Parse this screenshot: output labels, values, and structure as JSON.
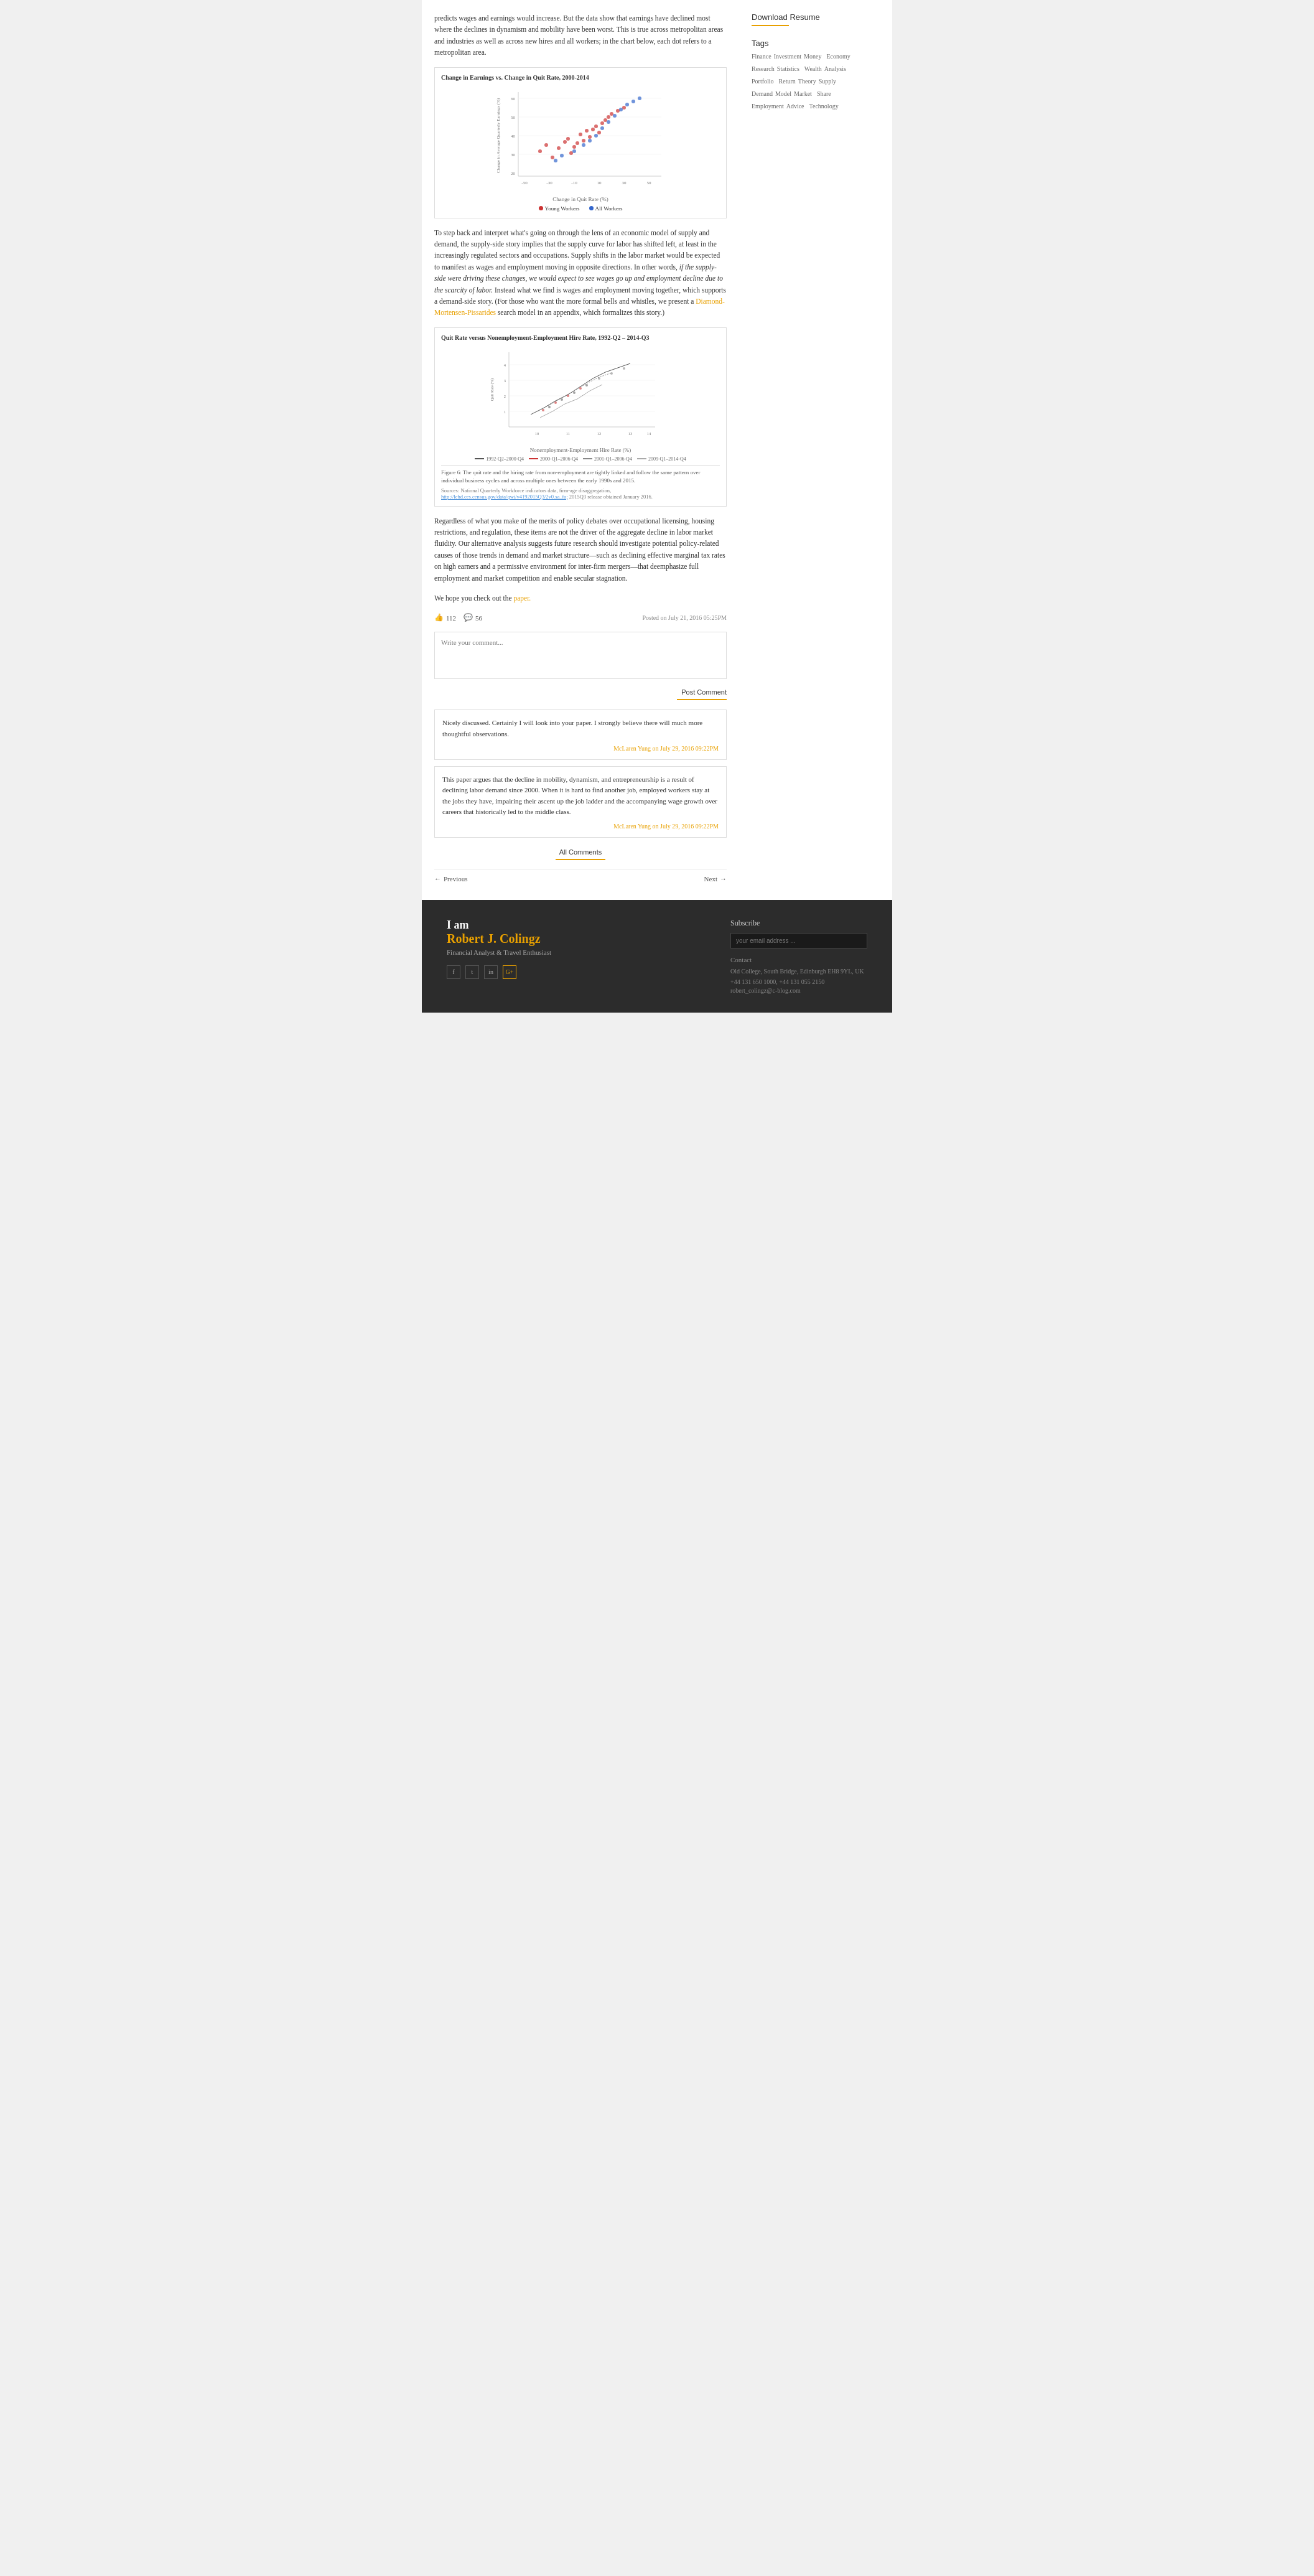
{
  "sidebar": {
    "download_resume": "Download Resume",
    "tags_title": "Tags",
    "tags": [
      "Finance",
      "Investment",
      "Money",
      "Economy",
      "Research",
      "Statistics",
      "Wealth",
      "Analysis",
      "Portfolio",
      "Return",
      "Theory",
      "Supply",
      "Demand",
      "Model",
      "Market",
      "Share",
      "Employment",
      "Advice",
      "Technology"
    ]
  },
  "article": {
    "intro_text": "predicts wages and earnings would increase. But the data show that earnings have declined most where the declines in dynamism and mobility have been worst. This is true across metropolitan areas and industries as well as across new hires and all workers; in the chart below, each dot refers to a metropolitan area.",
    "chart1_title": "Change in Earnings vs. Change in Quit Rate, 2000-2014",
    "chart1_x_label": "Change in Quit Rate (%)",
    "chart1_y_label": "Change in Average Quarterly Earnings (%)",
    "legend_young": "Young Workers",
    "legend_all": "All Workers",
    "body_text1": "To step back and interpret what's going on through the lens of an economic model of supply and demand, the supply-side story implies that the supply curve for labor has shifted left, at least in the increasingly regulated sectors and occupations. Supply shifts in the labor market would be expected to manifest as wages and employment moving in opposite directions. In other words,",
    "body_italic": "if the supply-side were driving these changes, we would expect to see wages go up and employment decline due to the scarcity of labor.",
    "body_text2": "Instead what we find is wages and employment moving together, which supports a demand-side story. (For those who want the more formal bells and whistles, we present a",
    "body_link": "Diamond-Mortensen-Pissarides",
    "body_text3": "search model in an appendix, which formalizes this story.)",
    "chart2_title": "Quit Rate versus Nonemployment-Employment Hire Rate, 1992-Q2 – 2014-Q3",
    "chart2_x_label": "Nonemployment-Employment Hire Rate (%)",
    "chart2_y_label": "Quit Rate (%)",
    "chart2_legend": [
      "1992-Q2–2000-Q4",
      "2000-Q1–2006-Q4",
      "2001-Q1–2006-Q4",
      "2009-Q1–2014-Q4"
    ],
    "figure_caption": "Figure 6: The quit rate and the hiring rate from non-employment are tightly linked and follow the same pattern over individual business cycles and across multiple ones between the early 1990s and 2015.",
    "figure_source_label": "Sources: National Quarterly Workforce indicators data, firm-age disaggregation,",
    "figure_source_url": "http://lehd.ces.census.gov/data/qwi/v4192015Q3/2v0.sa_fa;",
    "figure_source_end": "2015Q3 release obtained January 2016.",
    "body_text4": "Regardless of what you make of the merits of policy debates over occupational licensing, housing restrictions, and regulation, these items are not the driver of the aggregate decline in labor market fluidity. Our alternative analysis suggests future research should investigate potential policy-related causes of those trends in demand and market structure—such as declining effective marginal tax rates on high earners and a permissive environment for inter-firm mergers—that deemphasize full employment and market competition and enable secular stagnation.",
    "body_text5": "We hope you check out the",
    "paper_link": "paper.",
    "likes_count": "112",
    "comments_count": "56",
    "posted_on": "Posted on July 21, 2016 05:25PM",
    "comment_placeholder": "Write your comment...",
    "post_comment_label": "Post Comment",
    "comments": [
      {
        "text": "Nicely discussed. Certainly I will look into your paper. I strongly believe there will much more thoughtful observations.",
        "author": "McLaren Yung on July 29, 2016 09:22PM"
      },
      {
        "text": "This paper argues that the decline in mobility, dynamism, and entrepreneurship is a result of declining labor demand since 2000. When it is hard to find another job, employed workers stay at the jobs they have, impairing their ascent up the job ladder and the accompanying wage growth over careers that historically led to the middle class.",
        "author": "McLaren Yung on July 29, 2016 09:22PM"
      }
    ],
    "all_comments_label": "All Comments",
    "prev_label": "Previous",
    "next_label": "Next"
  },
  "footer": {
    "name_prefix": "I am",
    "name": "Robert J. Colingz",
    "subtitle": "Financial Analyst & Travel Enthusiast",
    "social": [
      "f",
      "t",
      "in",
      "G+"
    ],
    "subscribe_title": "Subscribe",
    "email_placeholder": "your email address ...",
    "contact_title": "Contact",
    "contact_address": "Old College, South Bridge, Edinburgh EH8 9YL, UK",
    "contact_phone1": "+44 131 650 1000, +44 131 055 2150",
    "contact_email": "robert_colingz@c-blog.com"
  }
}
